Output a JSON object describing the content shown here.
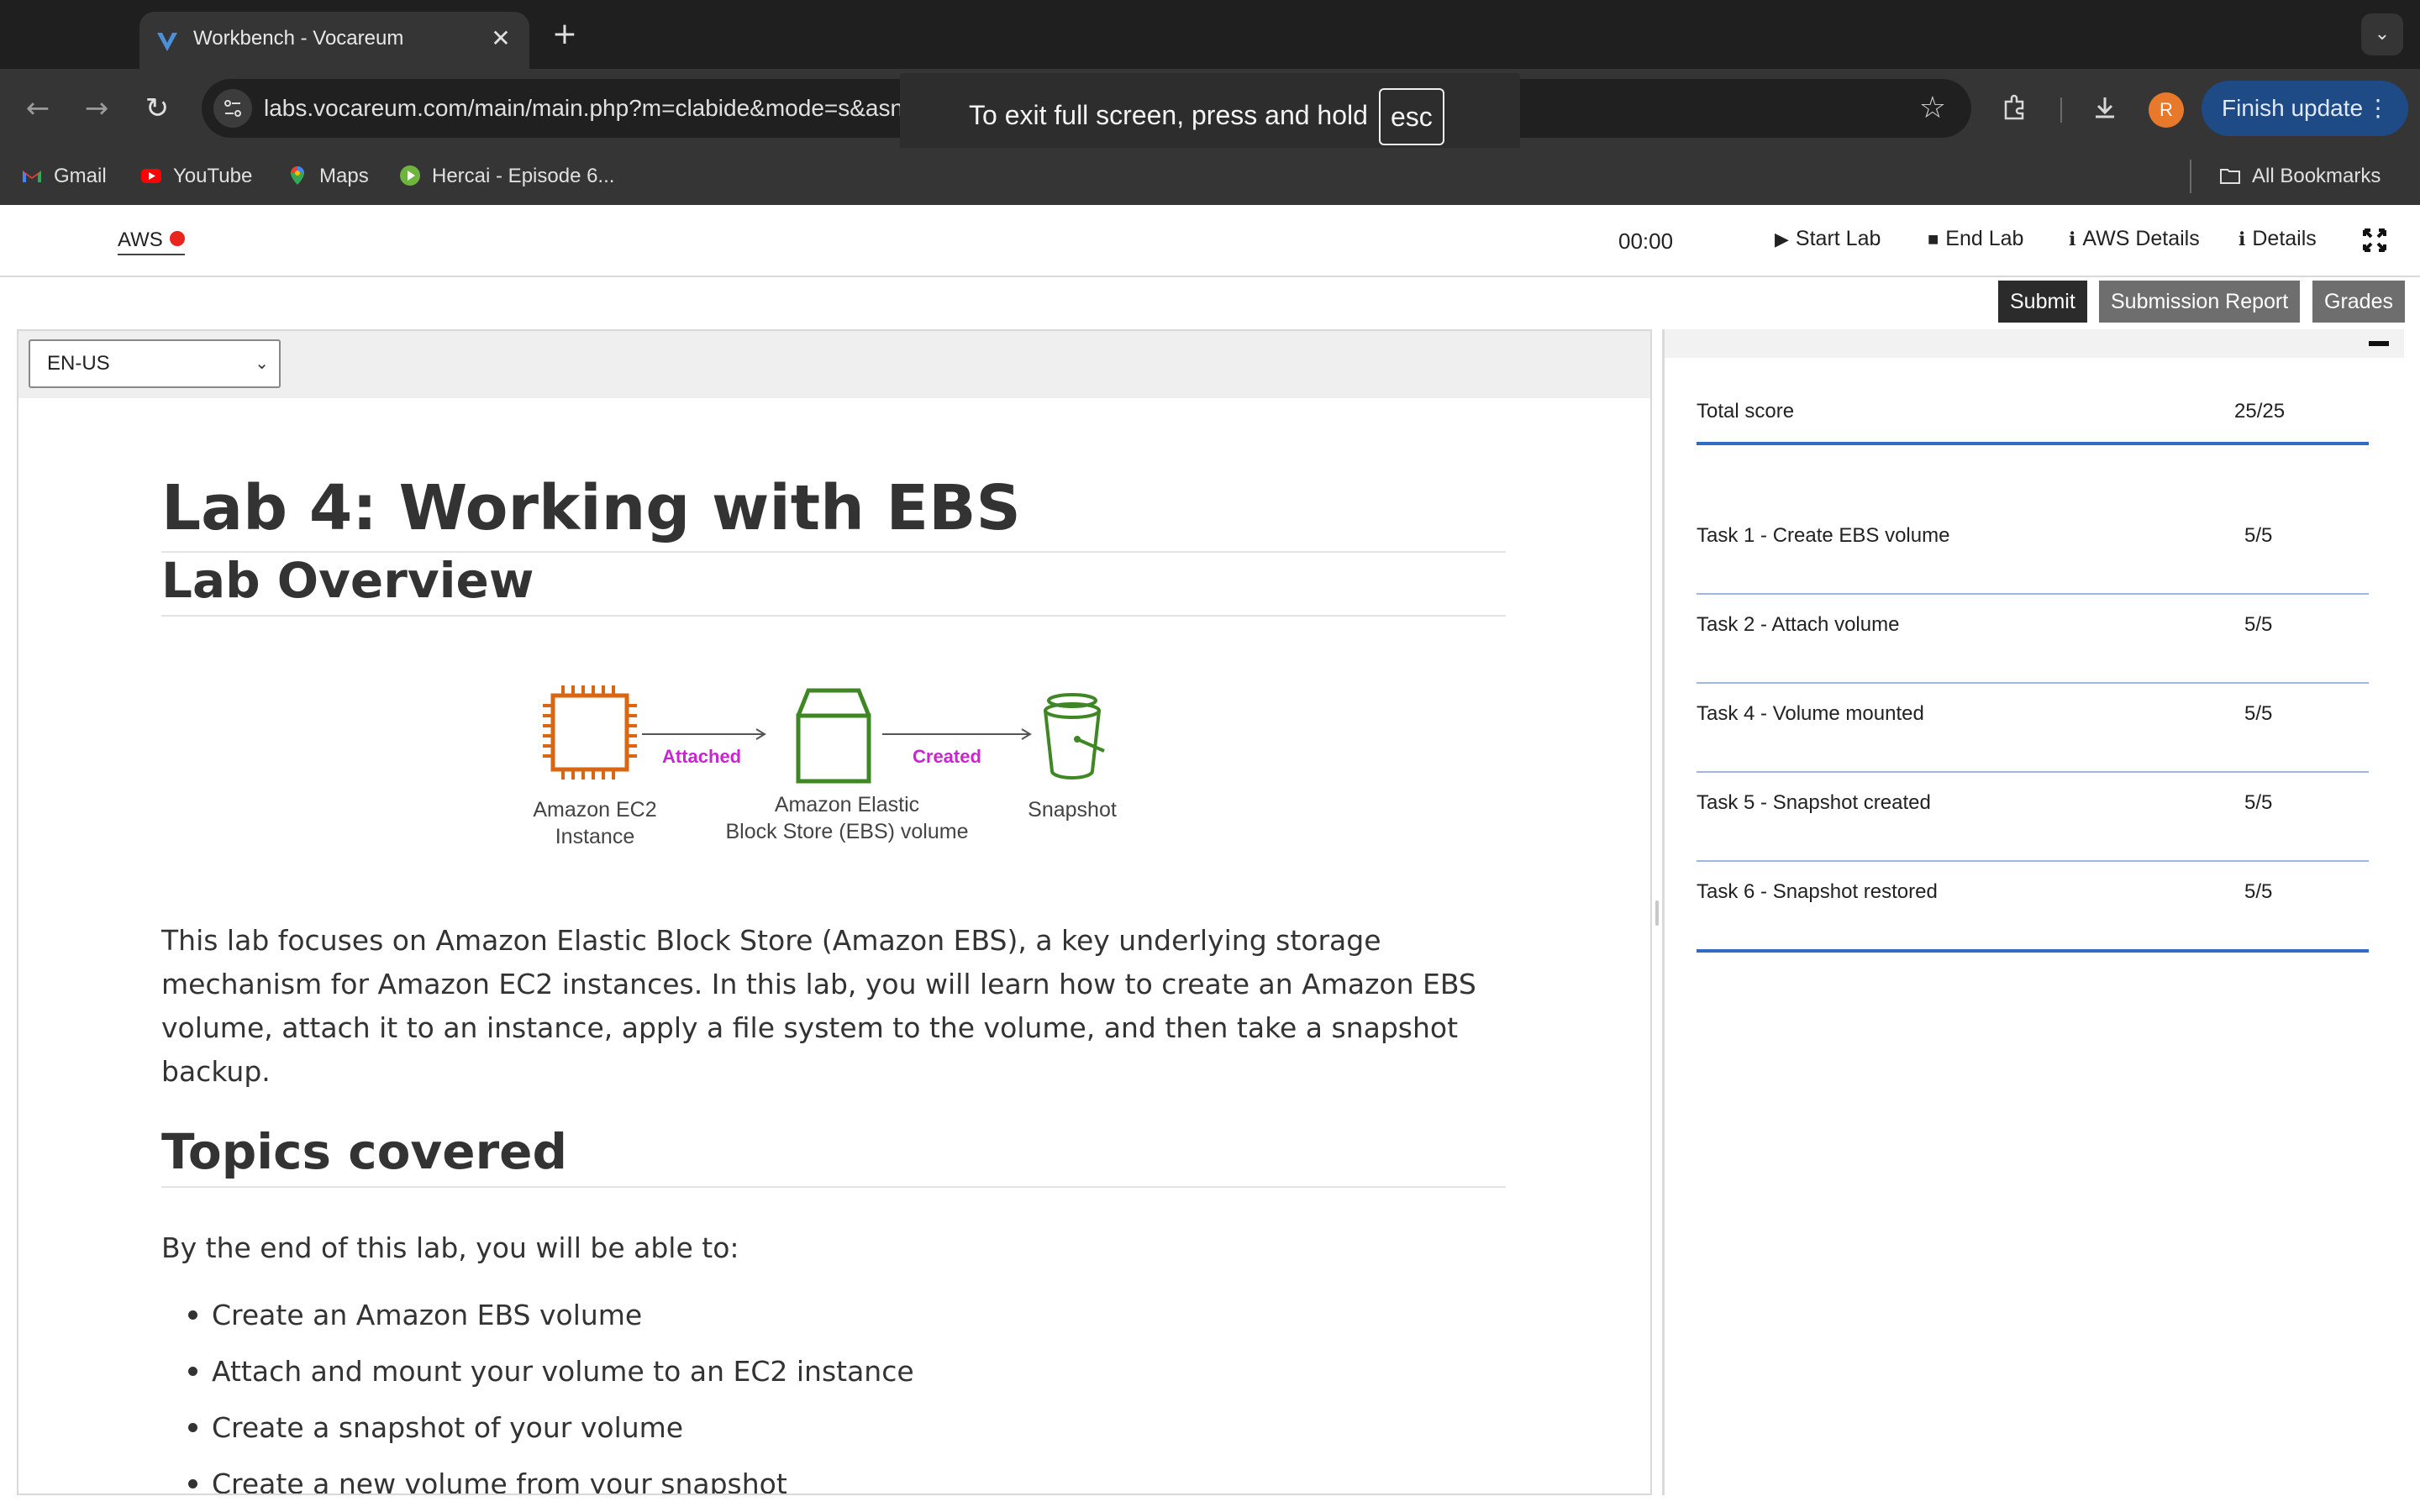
{
  "browser": {
    "tab_title": "Workbench - Vocareum",
    "new_tab": "+",
    "close": "✕",
    "url": "labs.vocareum.com/main/main.php?m=clabide&mode=s&asnid=3414958&stepid=3414957&hideNavBar=",
    "fullscreen_notice": "To exit full screen, press and hold",
    "fullscreen_key": "esc",
    "profile_initial": "R",
    "finish_update": "Finish update",
    "bookmarks": [
      {
        "label": "Gmail",
        "icon": "gmail-icon"
      },
      {
        "label": "YouTube",
        "icon": "youtube-icon"
      },
      {
        "label": "Maps",
        "icon": "maps-icon"
      },
      {
        "label": "Hercai - Episode 6...",
        "icon": "play-icon"
      }
    ],
    "all_bookmarks": "All Bookmarks"
  },
  "header": {
    "aws_label": "AWS",
    "aws_status_color": "#e8261e",
    "timer": "00:00",
    "start_lab": "Start Lab",
    "end_lab": "End Lab",
    "aws_details": "AWS Details",
    "details": "Details"
  },
  "actions": {
    "submit": "Submit",
    "submission_report": "Submission Report",
    "grades": "Grades"
  },
  "language": {
    "selected": "EN-US"
  },
  "doc": {
    "title": "Lab 4: Working with EBS",
    "overview_heading": "Lab Overview",
    "diagram": {
      "ec2_label_1": "Amazon EC2",
      "ec2_label_2": "Instance",
      "attached": "Attached",
      "ebs_label_1": "Amazon Elastic",
      "ebs_label_2": "Block Store (EBS) volume",
      "created": "Created",
      "snapshot": "Snapshot"
    },
    "overview_text": "This lab focuses on Amazon Elastic Block Store (Amazon EBS), a key underlying storage mechanism for Amazon EC2 instances. In this lab, you will learn how to create an Amazon EBS volume, attach it to an instance, apply a file system to the volume, and then take a snapshot backup.",
    "topics_heading": "Topics covered",
    "topics_intro": "By the end of this lab, you will be able to:",
    "topics": [
      "Create an Amazon EBS volume",
      "Attach and mount your volume to an EC2 instance",
      "Create a snapshot of your volume",
      "Create a new volume from your snapshot"
    ]
  },
  "scores": {
    "total_label": "Total score",
    "total_value": "25/25",
    "tasks": [
      {
        "label": "Task 1 - Create EBS volume",
        "value": "5/5"
      },
      {
        "label": "Task 2 - Attach volume",
        "value": "5/5"
      },
      {
        "label": "Task 4 - Volume mounted",
        "value": "5/5"
      },
      {
        "label": "Task 5 - Snapshot created",
        "value": "5/5"
      },
      {
        "label": "Task 6 - Snapshot restored",
        "value": "5/5"
      }
    ]
  },
  "colors": {
    "accent_blue": "#2f6cc4",
    "ec2_orange": "#d86613",
    "ebs_green": "#3f8624",
    "diagram_label": "#c925d1",
    "submit_bg": "#2b2b2b",
    "secondary_btn_bg": "#6e6e6e"
  }
}
